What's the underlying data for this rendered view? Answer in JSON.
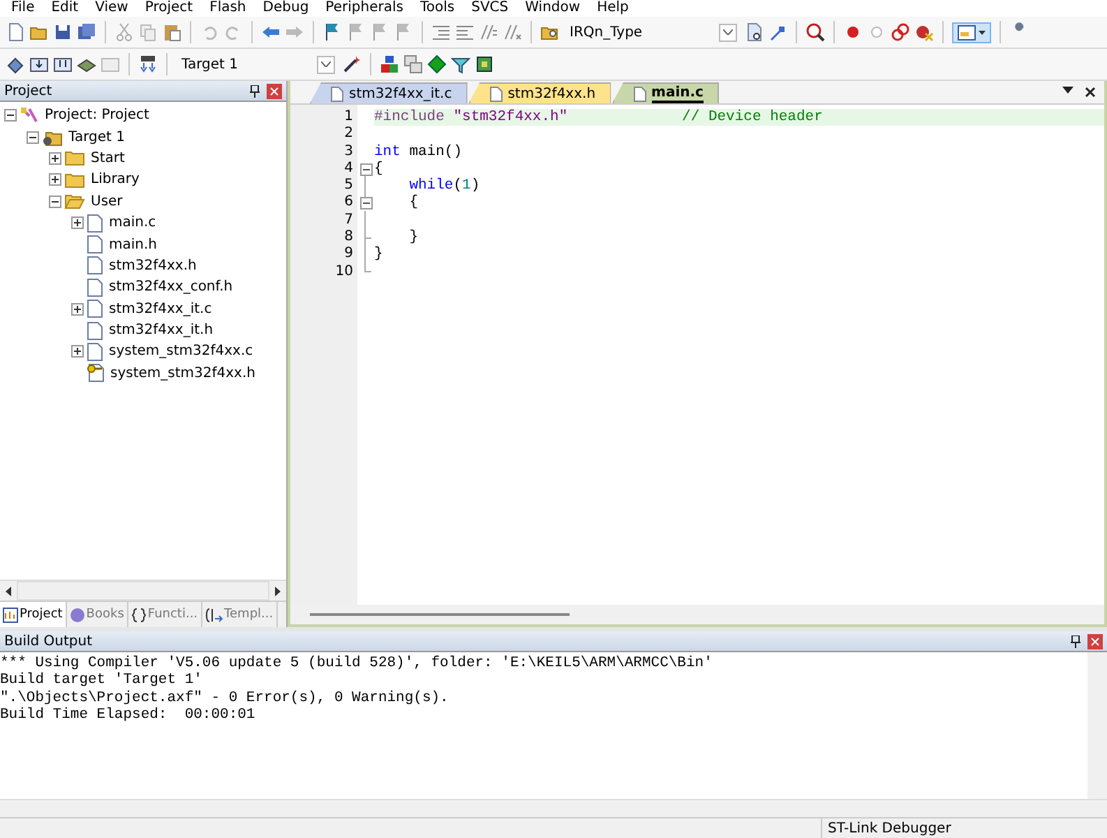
{
  "menu": [
    "File",
    "Edit",
    "View",
    "Project",
    "Flash",
    "Debug",
    "Peripherals",
    "Tools",
    "SVCS",
    "Window",
    "Help"
  ],
  "toolbar": {
    "find_value": "IRQn_Type",
    "target_value": "Target 1",
    "layout_pressed": true
  },
  "project_panel": {
    "title": "Project",
    "tree": [
      {
        "label": "Project: Project",
        "kind": "project",
        "expanded": true,
        "children": [
          {
            "label": "Target 1",
            "kind": "target",
            "expanded": true,
            "children": [
              {
                "label": "Start",
                "kind": "group",
                "expanded": false
              },
              {
                "label": "Library",
                "kind": "group",
                "expanded": false
              },
              {
                "label": "User",
                "kind": "group",
                "expanded": true,
                "children": [
                  {
                    "label": "main.c",
                    "kind": "file",
                    "expanded": false,
                    "expandable": true
                  },
                  {
                    "label": "main.h",
                    "kind": "file",
                    "expandable": false
                  },
                  {
                    "label": "stm32f4xx.h",
                    "kind": "file",
                    "expandable": false
                  },
                  {
                    "label": "stm32f4xx_conf.h",
                    "kind": "file",
                    "expandable": false
                  },
                  {
                    "label": "stm32f4xx_it.c",
                    "kind": "file",
                    "expanded": false,
                    "expandable": true
                  },
                  {
                    "label": "stm32f4xx_it.h",
                    "kind": "file",
                    "expandable": false
                  },
                  {
                    "label": "system_stm32f4xx.c",
                    "kind": "file",
                    "expanded": false,
                    "expandable": true
                  },
                  {
                    "label": "system_stm32f4xx.h",
                    "kind": "locked",
                    "expandable": false
                  }
                ]
              }
            ]
          }
        ]
      }
    ],
    "tabs": [
      {
        "label": "Project",
        "selected": true
      },
      {
        "label": "Books",
        "selected": false
      },
      {
        "label": "Functi...",
        "selected": false
      },
      {
        "label": "Templ...",
        "selected": false
      }
    ]
  },
  "editor": {
    "tabs": [
      {
        "label": "stm32f4xx_it.c",
        "color": "#c8d4ee",
        "selected": false
      },
      {
        "label": "stm32f4xx.h",
        "color": "#fde38c",
        "selected": false
      },
      {
        "label": "main.c",
        "color": "#c8d7a8",
        "selected": true
      }
    ],
    "lines": [
      {
        "number": "1",
        "current": true,
        "fold_toggle": false,
        "tokens": [
          {
            "text": "#include ",
            "kind": "preproc"
          },
          {
            "text": "\"stm32f4xx.h\"",
            "kind": "string"
          },
          {
            "text": "             // Device header",
            "kind": "comment"
          }
        ]
      },
      {
        "number": "2",
        "current": false,
        "fold_toggle": false
      },
      {
        "number": "3",
        "current": false,
        "fold_toggle": false,
        "tokens": [
          {
            "text": "int",
            "kind": "keyword"
          },
          {
            "text": " main()",
            "kind": "plain"
          }
        ]
      },
      {
        "number": "4",
        "current": false,
        "fold_toggle": true,
        "tokens": [
          {
            "text": "{",
            "kind": "plain"
          }
        ]
      },
      {
        "number": "5",
        "current": false,
        "fold_toggle": false,
        "tokens": [
          {
            "text": "    while",
            "kind": "keyword"
          },
          {
            "text": "(",
            "kind": "plain"
          },
          {
            "text": "1",
            "kind": "number"
          },
          {
            "text": ")",
            "kind": "plain"
          }
        ]
      },
      {
        "number": "6",
        "current": false,
        "fold_toggle": true,
        "tokens": [
          {
            "text": "    {",
            "kind": "plain"
          }
        ]
      },
      {
        "number": "7",
        "current": false,
        "fold_toggle": false
      },
      {
        "number": "8",
        "current": false,
        "fold_toggle": false,
        "tokens": [
          {
            "text": "    }",
            "kind": "plain"
          }
        ]
      },
      {
        "number": "9",
        "current": false,
        "fold_toggle": false,
        "tokens": [
          {
            "text": "}",
            "kind": "plain"
          }
        ]
      },
      {
        "number": "10",
        "current": false,
        "fold_toggle": false
      }
    ]
  },
  "build_output": {
    "title": "Build Output",
    "lines": [
      "*** Using Compiler 'V5.06 update 5 (build 528)', folder: 'E:\\KEIL5\\ARM\\ARMCC\\Bin'",
      "Build target 'Target 1'",
      "\".\\Objects\\Project.axf\" - 0 Error(s), 0 Warning(s).",
      "Build Time Elapsed:  00:00:01"
    ]
  },
  "status_bar": {
    "debugger": "ST-Link Debugger"
  }
}
